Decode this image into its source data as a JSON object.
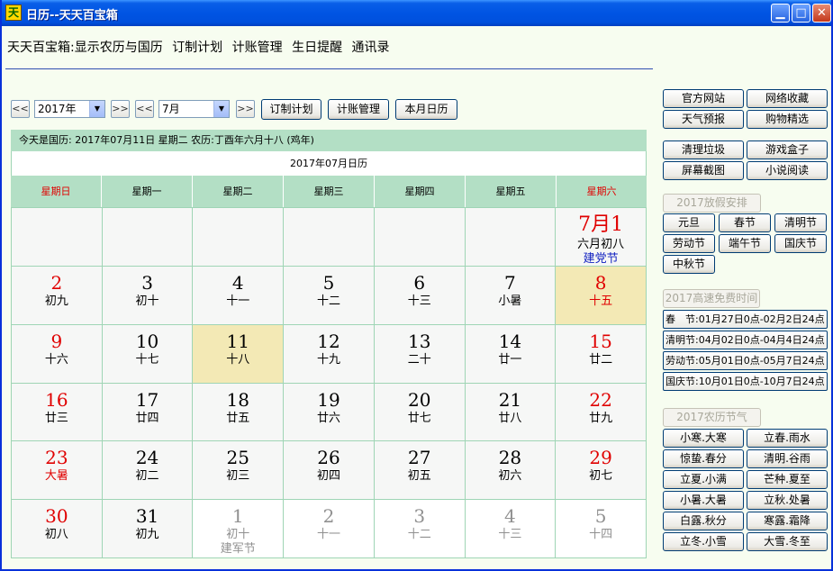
{
  "window": {
    "title": "日历--天天百宝箱",
    "icon_text": "天",
    "min": "▁",
    "max": "□",
    "close": "✕"
  },
  "menu": [
    "天天百宝箱:显示农历与国历",
    "订制计划",
    "计账管理",
    "生日提醒",
    "通讯录"
  ],
  "controls": {
    "prev": "<<",
    "next": ">>",
    "year": "2017年",
    "month": "7月",
    "plan": "订制计划",
    "account": "计账管理",
    "this_month": "本月日历"
  },
  "today_text": "今天是国历: 2017年07月11日 星期二 农历:丁酉年六月十八 (鸡年)",
  "calendar_title": "2017年07月日历",
  "weekdays": [
    "星期日",
    "星期一",
    "星期二",
    "星期三",
    "星期四",
    "星期五",
    "星期六"
  ],
  "cells": [
    {
      "d": "",
      "l": "",
      "f": ""
    },
    {
      "d": "",
      "l": "",
      "f": ""
    },
    {
      "d": "",
      "l": "",
      "f": ""
    },
    {
      "d": "",
      "l": "",
      "f": ""
    },
    {
      "d": "",
      "l": "",
      "f": ""
    },
    {
      "d": "",
      "l": "",
      "f": ""
    },
    {
      "d": "7月1",
      "l": "六月初八",
      "f": "建党节"
    },
    {
      "d": "2",
      "l": "初九",
      "f": ""
    },
    {
      "d": "3",
      "l": "初十",
      "f": ""
    },
    {
      "d": "4",
      "l": "十一",
      "f": ""
    },
    {
      "d": "5",
      "l": "十二",
      "f": ""
    },
    {
      "d": "6",
      "l": "十三",
      "f": ""
    },
    {
      "d": "7",
      "l": "小暑",
      "f": ""
    },
    {
      "d": "8",
      "l": "十五",
      "f": ""
    },
    {
      "d": "9",
      "l": "十六",
      "f": ""
    },
    {
      "d": "10",
      "l": "十七",
      "f": ""
    },
    {
      "d": "11",
      "l": "十八",
      "f": ""
    },
    {
      "d": "12",
      "l": "十九",
      "f": ""
    },
    {
      "d": "13",
      "l": "二十",
      "f": ""
    },
    {
      "d": "14",
      "l": "廿一",
      "f": ""
    },
    {
      "d": "15",
      "l": "廿二",
      "f": ""
    },
    {
      "d": "16",
      "l": "廿三",
      "f": ""
    },
    {
      "d": "17",
      "l": "廿四",
      "f": ""
    },
    {
      "d": "18",
      "l": "廿五",
      "f": ""
    },
    {
      "d": "19",
      "l": "廿六",
      "f": ""
    },
    {
      "d": "20",
      "l": "廿七",
      "f": ""
    },
    {
      "d": "21",
      "l": "廿八",
      "f": ""
    },
    {
      "d": "22",
      "l": "廿九",
      "f": ""
    },
    {
      "d": "23",
      "l": "大暑",
      "f": ""
    },
    {
      "d": "24",
      "l": "初二",
      "f": ""
    },
    {
      "d": "25",
      "l": "初三",
      "f": ""
    },
    {
      "d": "26",
      "l": "初四",
      "f": ""
    },
    {
      "d": "27",
      "l": "初五",
      "f": ""
    },
    {
      "d": "28",
      "l": "初六",
      "f": ""
    },
    {
      "d": "29",
      "l": "初七",
      "f": ""
    },
    {
      "d": "30",
      "l": "初八",
      "f": ""
    },
    {
      "d": "31",
      "l": "初九",
      "f": ""
    },
    {
      "d": "1",
      "l": "初十",
      "f": "建军节"
    },
    {
      "d": "2",
      "l": "十一",
      "f": ""
    },
    {
      "d": "3",
      "l": "十二",
      "f": ""
    },
    {
      "d": "4",
      "l": "十三",
      "f": ""
    },
    {
      "d": "5",
      "l": "十四",
      "f": ""
    }
  ],
  "links": [
    "官方网站",
    "网络收藏",
    "天气预报",
    "购物精选",
    "清理垃圾",
    "游戏盒子",
    "屏幕截图",
    "小说阅读"
  ],
  "holiday_header": "2017放假安排",
  "holidays": [
    "元旦",
    "春节",
    "清明节",
    "劳动节",
    "端午节",
    "国庆节",
    "中秋节"
  ],
  "toll_header": "2017高速免费时间",
  "toll": [
    "春　节:01月27日0点-02月2日24点",
    "清明节:04月02日0点-04月4日24点",
    "劳动节:05月01日0点-05月7日24点",
    "国庆节:10月01日0点-10月7日24点"
  ],
  "terms_header": "2017农历节气",
  "terms": [
    "小寒.大寒",
    "立春.雨水",
    "惊蛰.春分",
    "清明.谷雨",
    "立夏.小满",
    "芒种.夏至",
    "小暑.大暑",
    "立秋.处暑",
    "白露.秋分",
    "寒露.霜降",
    "立冬.小雪",
    "大雪.冬至"
  ],
  "colors": {
    "red": "#e00000",
    "green_header": "#b3dfc5",
    "highlight": "#f3e9b5",
    "blue_festival": "#1020c0"
  }
}
